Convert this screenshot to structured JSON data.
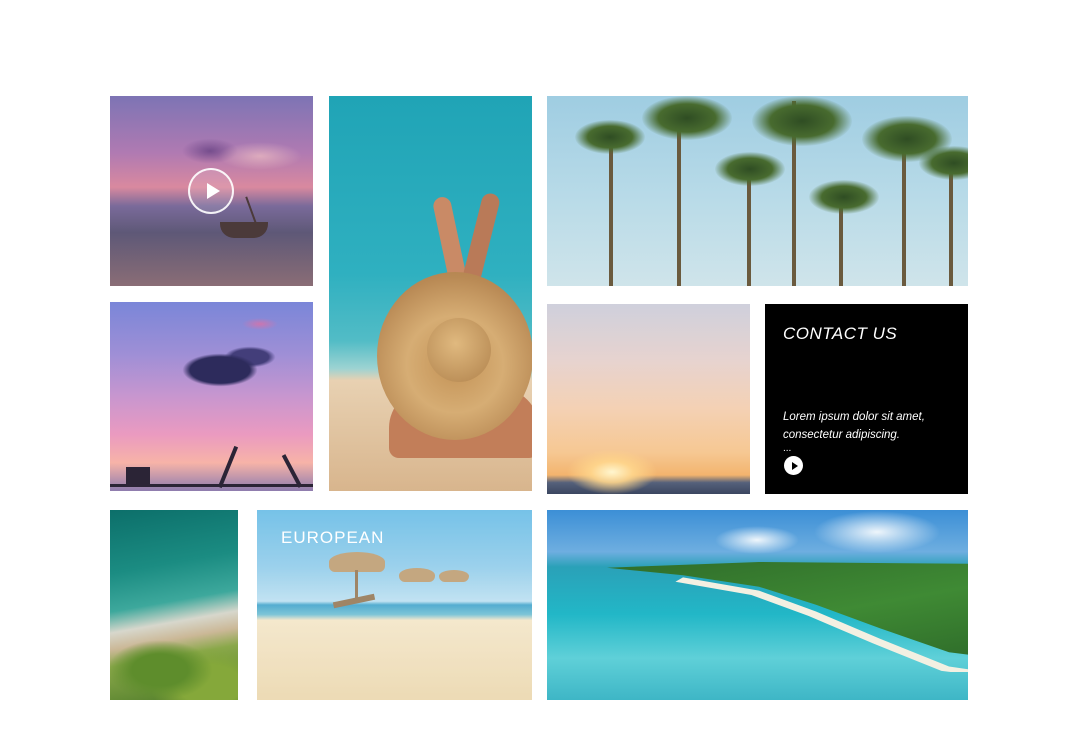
{
  "gallery": {
    "tiles": [
      {
        "id": "sunset-boat",
        "kind": "video"
      },
      {
        "id": "pink-sky",
        "kind": "image"
      },
      {
        "id": "hat-beach",
        "kind": "image"
      },
      {
        "id": "palms",
        "kind": "image"
      },
      {
        "id": "sunset-sea",
        "kind": "image"
      },
      {
        "id": "contact",
        "kind": "card"
      },
      {
        "id": "aerial",
        "kind": "image"
      },
      {
        "id": "european",
        "kind": "card"
      },
      {
        "id": "tropical",
        "kind": "image"
      }
    ]
  },
  "contact": {
    "title": "CONTACT US",
    "body": "Lorem ipsum dolor sit amet, consectetur adipiscing.",
    "more": "..."
  },
  "european": {
    "title": "EUROPEAN"
  },
  "icons": {
    "play": "play-icon",
    "arrow": "arrow-right-icon"
  },
  "colors": {
    "card_background": "#000000",
    "card_text": "#ffffff"
  }
}
